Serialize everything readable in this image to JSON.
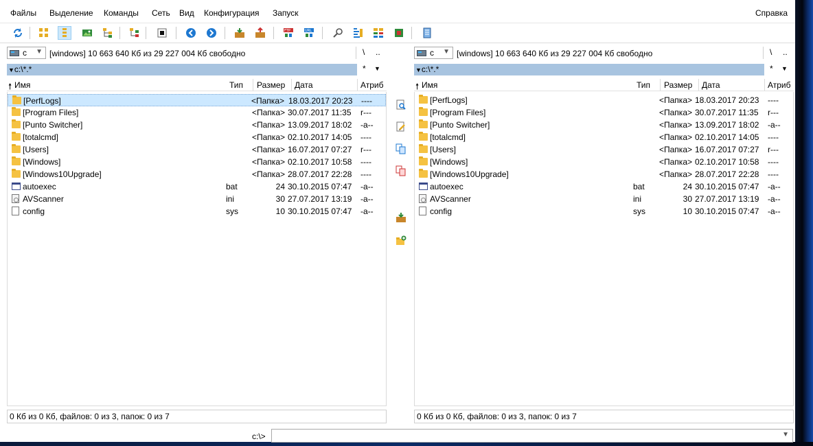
{
  "menu": {
    "items": [
      "Файлы",
      "Выделение",
      "Команды",
      "Сеть",
      "Вид",
      "Конфигурация",
      "Запуск"
    ],
    "help": "Справка"
  },
  "left_panel": {
    "drive": "c",
    "disk_info": "[windows]  10 663 640 Кб из 29 227 004 Кб свободно",
    "root_label": "\\",
    "up_label": "..",
    "path": "c:\\*.*",
    "path_star": "*",
    "columns": {
      "name": "Имя",
      "type": "Тип",
      "size": "Размер",
      "date": "Дата",
      "attr": "Атриб"
    },
    "files": [
      {
        "name": "[PerfLogs]",
        "ext": "",
        "size": "<Папка>",
        "date": "18.03.2017 20:23",
        "attr": "----",
        "kind": "folder",
        "selected": true
      },
      {
        "name": "[Program Files]",
        "ext": "",
        "size": "<Папка>",
        "date": "30.07.2017 11:35",
        "attr": "r---",
        "kind": "folder"
      },
      {
        "name": "[Punto Switcher]",
        "ext": "",
        "size": "<Папка>",
        "date": "13.09.2017 18:02",
        "attr": "-a--",
        "kind": "folder"
      },
      {
        "name": "[totalcmd]",
        "ext": "",
        "size": "<Папка>",
        "date": "02.10.2017 14:05",
        "attr": "----",
        "kind": "folder"
      },
      {
        "name": "[Users]",
        "ext": "",
        "size": "<Папка>",
        "date": "16.07.2017 07:27",
        "attr": "r---",
        "kind": "folder"
      },
      {
        "name": "[Windows]",
        "ext": "",
        "size": "<Папка>",
        "date": "02.10.2017 10:58",
        "attr": "----",
        "kind": "folder"
      },
      {
        "name": "[Windows10Upgrade]",
        "ext": "",
        "size": "<Папка>",
        "date": "28.07.2017 22:28",
        "attr": "----",
        "kind": "folder"
      },
      {
        "name": "autoexec",
        "ext": "bat",
        "size": "24",
        "date": "30.10.2015 07:47",
        "attr": "-a--",
        "kind": "bat"
      },
      {
        "name": "AVScanner",
        "ext": "ini",
        "size": "30",
        "date": "27.07.2017 13:19",
        "attr": "-a--",
        "kind": "ini"
      },
      {
        "name": "config",
        "ext": "sys",
        "size": "10",
        "date": "30.10.2015 07:47",
        "attr": "-a--",
        "kind": "doc"
      }
    ],
    "status": "0 Кб из 0 Кб, файлов: 0 из 3, папок: 0 из 7"
  },
  "right_panel": {
    "drive": "c",
    "disk_info": "[windows]  10 663 640 Кб из 29 227 004 Кб свободно",
    "root_label": "\\",
    "up_label": "..",
    "path": "c:\\*.*",
    "path_star": "*",
    "columns": {
      "name": "Имя",
      "type": "Тип",
      "size": "Размер",
      "date": "Дата",
      "attr": "Атриб"
    },
    "files": [
      {
        "name": "[PerfLogs]",
        "ext": "",
        "size": "<Папка>",
        "date": "18.03.2017 20:23",
        "attr": "----",
        "kind": "folder"
      },
      {
        "name": "[Program Files]",
        "ext": "",
        "size": "<Папка>",
        "date": "30.07.2017 11:35",
        "attr": "r---",
        "kind": "folder"
      },
      {
        "name": "[Punto Switcher]",
        "ext": "",
        "size": "<Папка>",
        "date": "13.09.2017 18:02",
        "attr": "-a--",
        "kind": "folder"
      },
      {
        "name": "[totalcmd]",
        "ext": "",
        "size": "<Папка>",
        "date": "02.10.2017 14:05",
        "attr": "----",
        "kind": "folder"
      },
      {
        "name": "[Users]",
        "ext": "",
        "size": "<Папка>",
        "date": "16.07.2017 07:27",
        "attr": "r---",
        "kind": "folder"
      },
      {
        "name": "[Windows]",
        "ext": "",
        "size": "<Папка>",
        "date": "02.10.2017 10:58",
        "attr": "----",
        "kind": "folder"
      },
      {
        "name": "[Windows10Upgrade]",
        "ext": "",
        "size": "<Папка>",
        "date": "28.07.2017 22:28",
        "attr": "----",
        "kind": "folder"
      },
      {
        "name": "autoexec",
        "ext": "bat",
        "size": "24",
        "date": "30.10.2015 07:47",
        "attr": "-a--",
        "kind": "bat"
      },
      {
        "name": "AVScanner",
        "ext": "ini",
        "size": "30",
        "date": "27.07.2017 13:19",
        "attr": "-a--",
        "kind": "ini"
      },
      {
        "name": "config",
        "ext": "sys",
        "size": "10",
        "date": "30.10.2015 07:47",
        "attr": "-a--",
        "kind": "doc"
      }
    ],
    "status": "0 Кб из 0 Кб, файлов: 0 из 3, папок: 0 из 7"
  },
  "toolbar": {
    "icons": [
      "refresh-icon",
      "brief-view-icon",
      "full-view-icon",
      "thumbnails-view-icon",
      "tree-view-icon",
      "invert-selection-icon",
      "dos-window-icon",
      "back-icon",
      "forward-icon",
      "pack-icon",
      "unpack-icon",
      "ftp-connect-icon",
      "url-connect-icon",
      "find-icon",
      "multi-rename-icon",
      "compare-dirs-icon",
      "sync-dirs-icon",
      "notepad-icon"
    ]
  },
  "midbar": {
    "icons": [
      "view-file-icon",
      "edit-file-icon",
      "copy-files-icon",
      "move-files-icon",
      "pack-files-icon",
      "new-folder-icon"
    ]
  },
  "cmdline": {
    "prompt": "c:\\>",
    "value": ""
  },
  "colors": {
    "selection": "#cce8ff",
    "pathbar": "#a8c4e0",
    "folder": "#f5c242",
    "accent_blue": "#1e78d0"
  }
}
